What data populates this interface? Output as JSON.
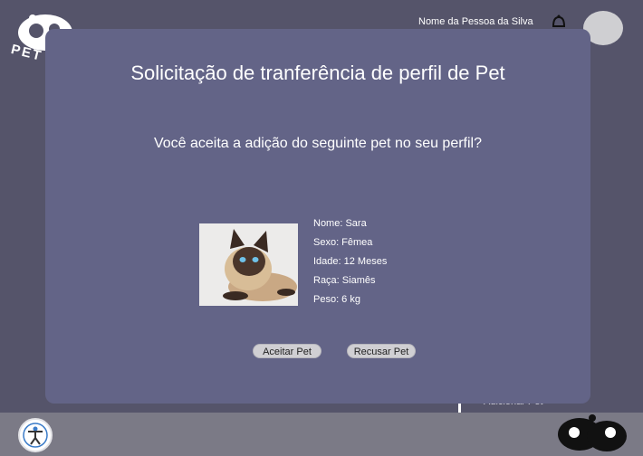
{
  "header": {
    "logo_text": "PET",
    "user_name": "Nome da Pessoa da Silva"
  },
  "background_menu": {
    "peek_item": "Adicionar Pet"
  },
  "modal": {
    "title": "Solicitação de tranferência de perfil de Pet",
    "question": "Você aceita a adição do seguinte pet no seu perfil?",
    "pet": {
      "name": "Nome: Sara",
      "sex": "Sexo: Fêmea",
      "age": "Idade: 12 Meses",
      "breed": "Raça: Siamês",
      "weight": "Peso: 6 kg"
    },
    "accept_label": "Aceitar Pet",
    "refuse_label": "Recusar Pet"
  },
  "colors": {
    "page_bg": "#55546a",
    "modal_bg": "#636487",
    "footer_bg": "#7b7a86",
    "button_bg": "#d0cfd3"
  },
  "icons": [
    "pet-logo-icon",
    "bell-icon",
    "avatar",
    "accessibility-icon",
    "footer-pets-logo-icon"
  ]
}
